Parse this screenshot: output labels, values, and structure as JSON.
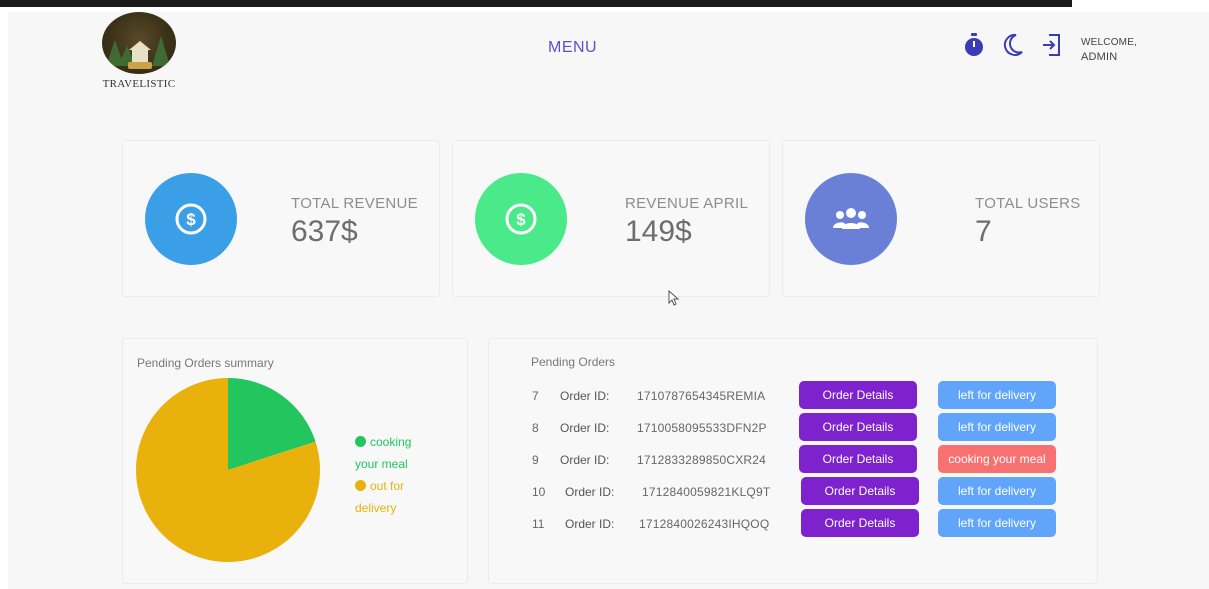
{
  "header": {
    "logo_text": "TRAVELISTIC",
    "menu_label": "MENU",
    "welcome_line1": "WELCOME,",
    "welcome_line2": "ADMIN",
    "icons": [
      "timer-icon",
      "moon-icon",
      "logout-icon"
    ]
  },
  "stats": [
    {
      "label": "TOTAL REVENUE",
      "value": "637$",
      "icon": "dollar-icon",
      "color": "#3b9fe8"
    },
    {
      "label": "REVENUE APRIL",
      "value": "149$",
      "icon": "dollar-icon",
      "color": "#4ae98a"
    },
    {
      "label": "TOTAL USERS",
      "value": "7",
      "icon": "users-icon",
      "color": "#6a80d6"
    }
  ],
  "pie_card": {
    "title": "Pending Orders summary",
    "legend": [
      {
        "label_line1": "cooking",
        "label_line2": "your meal",
        "color": "#22c55e"
      },
      {
        "label_line1": "out for",
        "label_line2": "delivery",
        "color": "#e8b10b"
      }
    ]
  },
  "chart_data": {
    "type": "pie",
    "title": "Pending Orders summary",
    "slices": [
      {
        "label": "cooking your meal",
        "value": 1,
        "color": "#22c55e"
      },
      {
        "label": "out for delivery",
        "value": 4,
        "color": "#e8b10b"
      }
    ]
  },
  "orders_card": {
    "title": "Pending Orders",
    "id_label": "Order ID:",
    "details_label": "Order Details",
    "orders": [
      {
        "num": "7",
        "id": "1710787654345REMIA",
        "status": "left for delivery",
        "status_color": "#60a5fa"
      },
      {
        "num": "8",
        "id": "1710058095533DFN2P",
        "status": "left for delivery",
        "status_color": "#60a5fa"
      },
      {
        "num": "9",
        "id": "1712833289850CXR24",
        "status": "cooking your meal",
        "status_color": "#f87171"
      },
      {
        "num": "10",
        "id": "1712840059821KLQ9T",
        "status": "left for delivery",
        "status_color": "#60a5fa"
      },
      {
        "num": "11",
        "id": "1712840026243IHQOQ",
        "status": "left for delivery",
        "status_color": "#60a5fa"
      }
    ]
  }
}
